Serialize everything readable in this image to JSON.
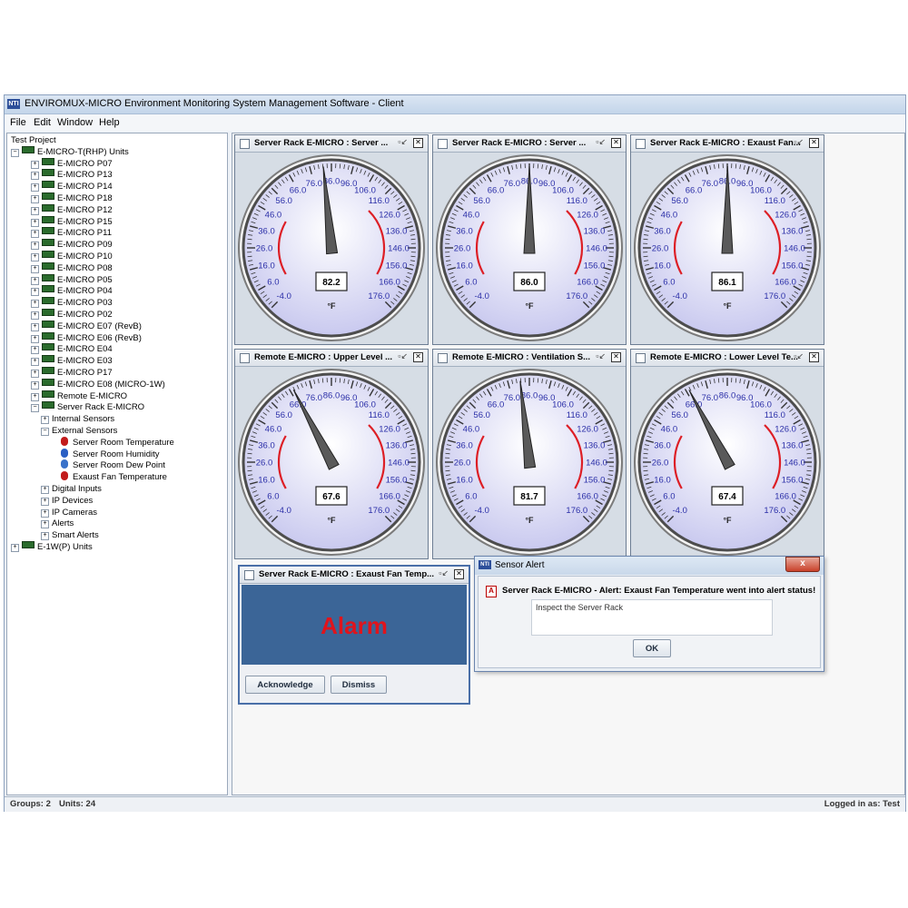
{
  "app": {
    "title": "ENVIROMUX-MICRO Environment Monitoring System Management Software - Client",
    "logo": "NTI"
  },
  "menu": [
    "File",
    "Edit",
    "Window",
    "Help"
  ],
  "tree": {
    "project": "Test Project",
    "root_group": "E-MICRO-T(RHP) Units",
    "units": [
      "E-MICRO P07",
      "E-MICRO P13",
      "E-MICRO P14",
      "E-MICRO P18",
      "E-MICRO P12",
      "E-MICRO P15",
      "E-MICRO P11",
      "E-MICRO P09",
      "E-MICRO P10",
      "E-MICRO P08",
      "E-MICRO P05",
      "E-MICRO P04",
      "E-MICRO P03",
      "E-MICRO P02",
      "E-MICRO E07 (RevB)",
      "E-MICRO E06 (RevB)",
      "E-MICRO E04",
      "E-MICRO E03",
      "E-MICRO P17",
      "E-MICRO E08 (MICRO-1W)",
      "Remote E-MICRO"
    ],
    "expanded_unit": "Server Rack E-MICRO",
    "internal_sensors": "Internal Sensors",
    "external_sensors": "External Sensors",
    "sensors": [
      {
        "label": "Server Room Temperature",
        "icon": "thermometer-icon"
      },
      {
        "label": "Server Room Humidity",
        "icon": "humidity-drop-icon"
      },
      {
        "label": "Server Room Dew Point",
        "icon": "dew-point-icon"
      },
      {
        "label": "Exaust Fan Temperature",
        "icon": "thermometer-icon"
      }
    ],
    "unit_children": [
      "Digital Inputs",
      "IP Devices",
      "IP Cameras",
      "Alerts",
      "Smart Alerts"
    ],
    "second_group": "E-1W(P) Units"
  },
  "gauges": [
    {
      "title": "Server Rack E-MICRO : Server ...",
      "value": "82.2",
      "reading": 82.2
    },
    {
      "title": "Server Rack E-MICRO : Server ...",
      "value": "86.0",
      "reading": 86.0
    },
    {
      "title": "Server Rack E-MICRO : Exaust Fan...",
      "value": "86.1",
      "reading": 86.1
    },
    {
      "title": "Remote E-MICRO : Upper Level ...",
      "value": "67.6",
      "reading": 67.6
    },
    {
      "title": "Remote E-MICRO : Ventilation S...",
      "value": "81.7",
      "reading": 81.7
    },
    {
      "title": "Remote E-MICRO : Lower Level Te...",
      "value": "67.4",
      "reading": 67.4
    }
  ],
  "gauge_scale": {
    "ticks": [
      "-4.0",
      "6.0",
      "16.0",
      "26.0",
      "36.0",
      "46.0",
      "56.0",
      "66.0",
      "76.0",
      "86.0",
      "96.0",
      "106.0",
      "116.0",
      "126.0",
      "136.0",
      "146.0",
      "156.0",
      "166.0",
      "176.0"
    ],
    "min": -4,
    "max": 176,
    "unit": "°F"
  },
  "colors": {
    "gauge_face": "#c9c9ef",
    "warning_arc": "#dd1f26",
    "alarm_panel": "#3b6597",
    "alarm_text": "#e0141c"
  },
  "alarm_window": {
    "title": "Server Rack E-MICRO : Exaust Fan Temp...",
    "alarm_text": "Alarm",
    "acknowledge": "Acknowledge",
    "dismiss": "Dismiss"
  },
  "alert_dialog": {
    "title": "Sensor Alert",
    "logo": "NTI",
    "message": "Server Rack E-MICRO - Alert: Exaust Fan Temperature went into alert status!",
    "note": "Inspect the Server Rack",
    "ok": "OK",
    "close": "x"
  },
  "status": {
    "groups": "Groups: 2",
    "units": "Units: 24",
    "login": "Logged in as: Test"
  }
}
